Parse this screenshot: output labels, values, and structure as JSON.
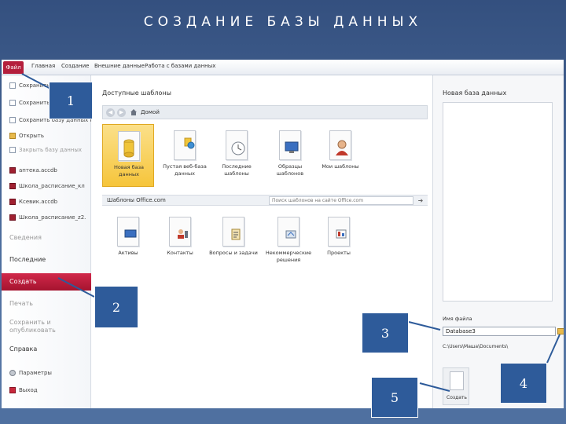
{
  "slide": {
    "title": "СОЗДАНИЕ БАЗЫ ДАННЫХ"
  },
  "ribbon": {
    "tabs": [
      "Файл",
      "Главная",
      "Создание",
      "Внешние данные",
      "Работа с базами данных"
    ]
  },
  "left_menu": {
    "items": [
      {
        "label": "Сохранить",
        "icon": "save-icon",
        "muted": false
      },
      {
        "label": "Сохранить объект как",
        "icon": "save-as-icon",
        "muted": false
      },
      {
        "label": "Сохранить базу данных как",
        "icon": "save-db-icon",
        "muted": false
      },
      {
        "label": "Открыть",
        "icon": "open-folder-icon",
        "muted": false
      },
      {
        "label": "Закрыть базу данных",
        "icon": "close-db-icon",
        "muted": true
      }
    ],
    "recent": [
      "аптека.accdb",
      "Школа_расписание_кл",
      "Ксевик.accdb",
      "Школа_расписание_z2."
    ],
    "sections": [
      {
        "label": "Сведения",
        "muted": true
      },
      {
        "label": "Последние",
        "muted": false
      },
      {
        "label": "Создать",
        "muted": false,
        "active": true
      },
      {
        "label": "Печать",
        "muted": true
      },
      {
        "label": "Сохранить и опубликовать",
        "muted": true
      },
      {
        "label": "Справка",
        "muted": false
      }
    ],
    "footer": [
      {
        "label": "Параметры",
        "icon": "gear-icon"
      },
      {
        "label": "Выход",
        "icon": "exit-icon"
      }
    ]
  },
  "templates": {
    "heading": "Доступные шаблоны",
    "nav_home": "Домой",
    "row1": [
      {
        "label": "Новая база данных",
        "selected": true
      },
      {
        "label": "Пустая веб-база данных",
        "selected": false
      },
      {
        "label": "Последние шаблоны",
        "selected": false
      },
      {
        "label": "Образцы шаблонов",
        "selected": false
      },
      {
        "label": "Мои шаблоны",
        "selected": false
      }
    ],
    "office_strip": "Шаблоны Office.com",
    "search_placeholder": "Поиск шаблонов на сайте Office.com",
    "row2": [
      {
        "label": "Активы"
      },
      {
        "label": "Контакты"
      },
      {
        "label": "Вопросы и задачи"
      },
      {
        "label": "Некоммерческие решения"
      },
      {
        "label": "Проекты"
      }
    ]
  },
  "right_panel": {
    "title": "Новая база данных",
    "file_name_label": "Имя файла",
    "file_name_value": "Database3",
    "path": "C:\\Users\\Маша\\Documents\\",
    "create_label": "Создать"
  },
  "callouts": [
    "1",
    "2",
    "3",
    "4",
    "5"
  ],
  "colors": {
    "file_tab": "#b41f3c",
    "active_section": "#c21f40",
    "callout_fill": "#2e5b9a",
    "slide_bg": "#3d5c8c",
    "selected_tile": "#f6c53b"
  }
}
